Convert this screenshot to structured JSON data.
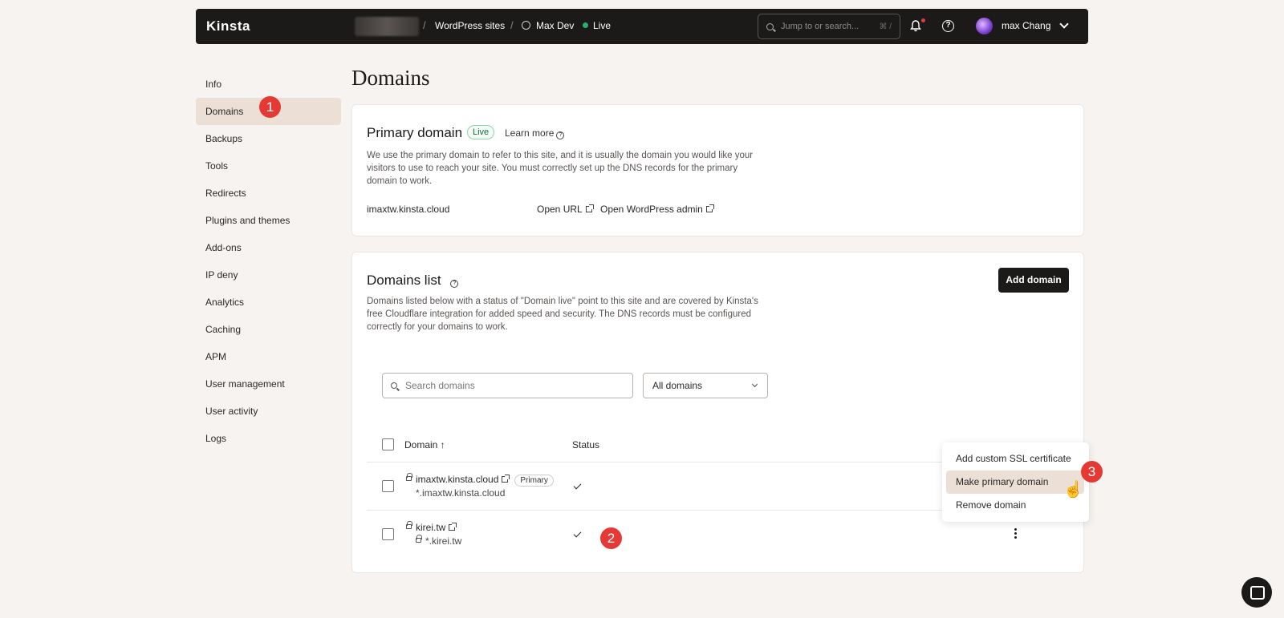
{
  "topbar": {
    "logo": "Kinsta",
    "breadcrumb_1": "WordPress sites",
    "breadcrumb_2": "Max Dev",
    "status": "Live",
    "search_placeholder": "Jump to or search...",
    "search_shortcut": "⌘ /",
    "username": "max Chang"
  },
  "sidebar": {
    "items": [
      {
        "label": "Info"
      },
      {
        "label": "Domains"
      },
      {
        "label": "Backups"
      },
      {
        "label": "Tools"
      },
      {
        "label": "Redirects"
      },
      {
        "label": "Plugins and themes"
      },
      {
        "label": "Add-ons"
      },
      {
        "label": "IP deny"
      },
      {
        "label": "Analytics"
      },
      {
        "label": "Caching"
      },
      {
        "label": "APM"
      },
      {
        "label": "User management"
      },
      {
        "label": "User activity"
      },
      {
        "label": "Logs"
      }
    ]
  },
  "page": {
    "title": "Domains"
  },
  "primary_domain": {
    "heading": "Primary domain",
    "badge": "Live",
    "learn_more": "Learn more",
    "description": "We use the primary domain to refer to this site, and it is usually the domain you would like your visitors to use to reach your site. You must correctly set up the DNS records for the primary domain to work.",
    "domain": "imaxtw.kinsta.cloud",
    "open_url": "Open URL",
    "open_admin": "Open WordPress admin"
  },
  "domains_list": {
    "heading": "Domains list",
    "add_button": "Add domain",
    "description": "Domains listed below with a status of \"Domain live\" point to this site and are covered by Kinsta's free Cloudflare integration for added speed and security. The DNS records must be configured correctly for your domains to work.",
    "search_placeholder": "Search domains",
    "filter_value": "All domains",
    "columns": {
      "domain": "Domain ↑",
      "status": "Status"
    },
    "rows": [
      {
        "domain": "imaxtw.kinsta.cloud",
        "tag": "Primary",
        "sub": "*.imaxtw.kinsta.cloud"
      },
      {
        "domain": "kirei.tw",
        "sub": "*.kirei.tw"
      }
    ]
  },
  "context_menu": {
    "items": [
      {
        "label": "Add custom SSL certificate"
      },
      {
        "label": "Make primary domain"
      },
      {
        "label": "Remove domain"
      }
    ]
  },
  "markers": {
    "m1": "1",
    "m2": "2",
    "m3": "3"
  },
  "colors": {
    "accent": "#e53935",
    "live": "#29b06b",
    "active_bg": "#ecdfd6"
  }
}
